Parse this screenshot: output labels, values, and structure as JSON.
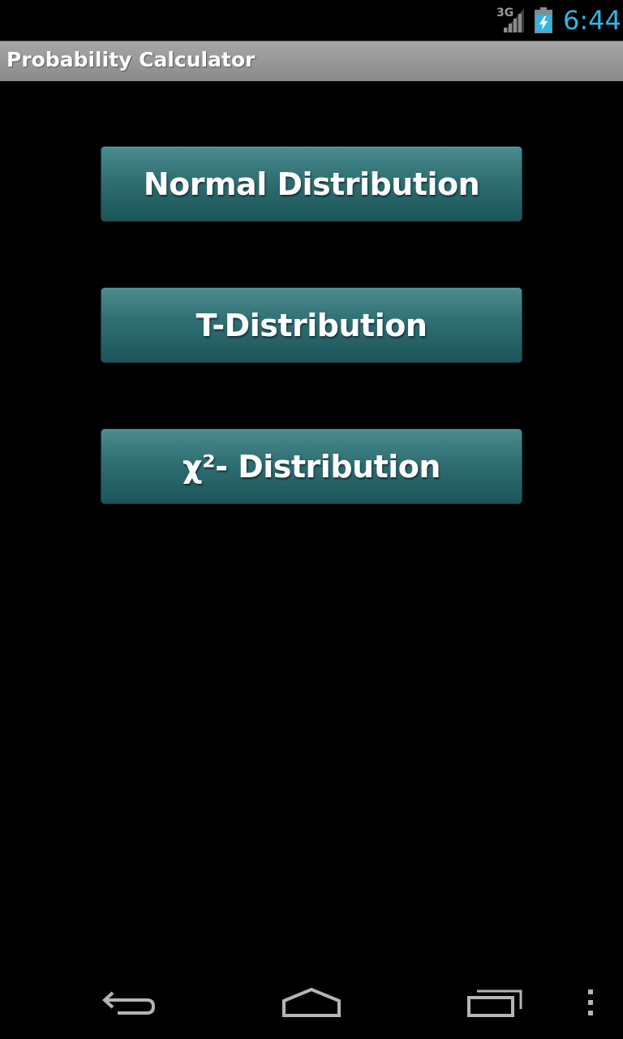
{
  "status_bar": {
    "network_type": "3G",
    "time": "6:44",
    "signal_icon": "signal-strength-icon",
    "battery_icon": "battery-charging-icon",
    "clock_color": "#33b5e5"
  },
  "title_bar": {
    "title": "Probability Calculator"
  },
  "buttons": {
    "normal": "Normal Distribution",
    "t": "T-Distribution",
    "chi": "χ²- Distribution"
  },
  "nav_bar": {
    "back_icon": "back-arrow-icon",
    "home_icon": "home-icon",
    "recent_icon": "recent-apps-icon",
    "menu_icon": "overflow-menu-icon"
  },
  "colors": {
    "button_top": "#4b8c8f",
    "button_bottom": "#1c5459",
    "title_bar": "#9a9a9a"
  }
}
